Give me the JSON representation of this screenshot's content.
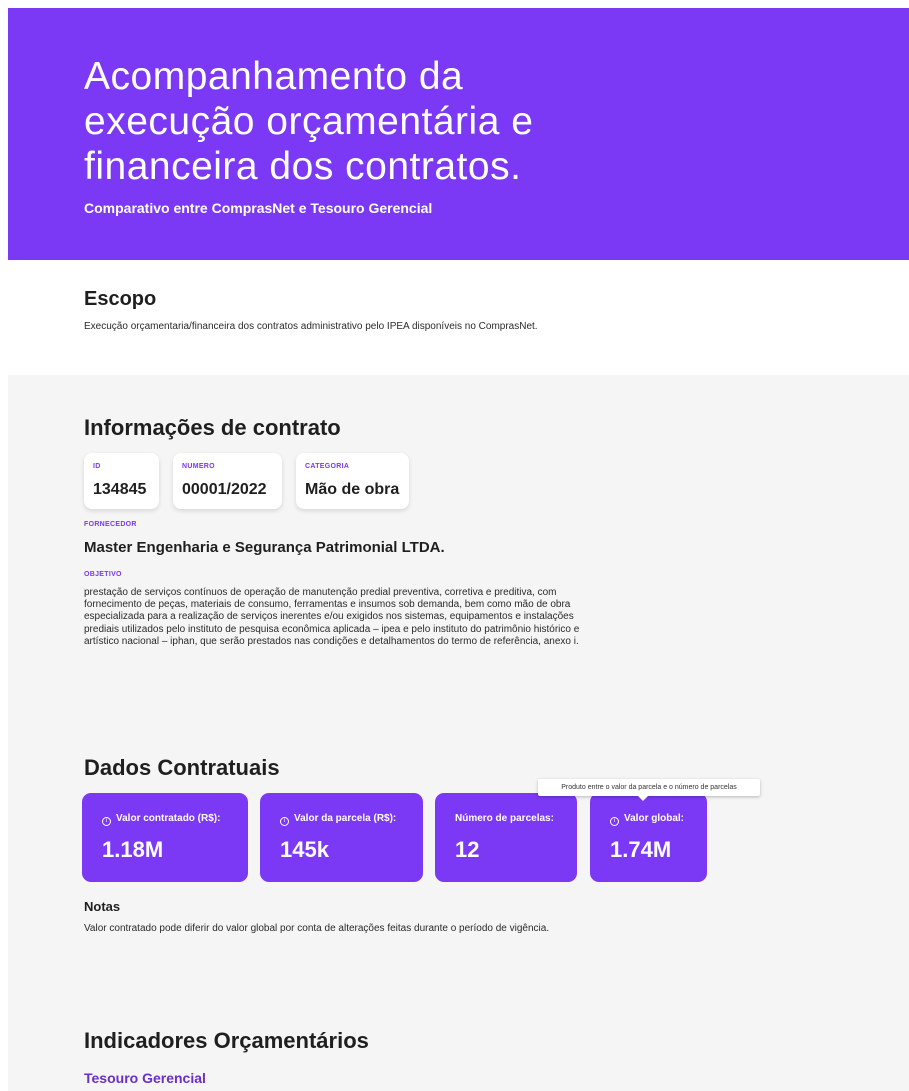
{
  "hero": {
    "title": "Acompanhamento da execução orçamentária e financeira dos contratos.",
    "subtitle": "Comparativo entre ComprasNet e Tesouro Gerencial"
  },
  "scope": {
    "title": "Escopo",
    "text": "Execução orçamentaria/financeira dos contratos administrativo pelo IPEA disponíveis no ComprasNet."
  },
  "contract_info": {
    "title": "Informações de contrato",
    "cards": [
      {
        "label": "ID",
        "value": "134845"
      },
      {
        "label": "NUMERO",
        "value": "00001/2022"
      },
      {
        "label": "CATEGORIA",
        "value": "Mão de obra"
      }
    ],
    "supplier_label": "FORNECEDOR",
    "supplier": "Master Engenharia e Segurança Patrimonial LTDA.",
    "objective_label": "OBJETIVO",
    "objective": "prestação de serviços contínuos de operação de manutenção predial preventiva, corretiva e preditiva, com fornecimento de peças, materiais de consumo, ferramentas e insumos sob demanda, bem como mão de obra especializada para a realização de serviços inerentes e/ou exigidos nos sistemas, equipamentos e instalações prediais utilizados pelo instituto de pesquisa econômica aplicada – ipea e pelo instituto do patrimônio histórico e artístico nacional – iphan, que serão prestados nas condições e detalhamentos do termo de referência, anexo i."
  },
  "contract_data": {
    "title": "Dados Contratuais",
    "metrics": [
      {
        "label": "Valor contratado (R$):",
        "value": "1.18M",
        "info_icon": "info-icon"
      },
      {
        "label": "Valor da parcela (R$):",
        "value": "145k",
        "info_icon": "info-icon"
      },
      {
        "label": "Número de parcelas:",
        "value": "12"
      },
      {
        "label": "Valor global:",
        "value": "1.74M",
        "info_icon": "info-icon"
      }
    ],
    "tooltip": "Produto entre o valor da parcela e o número de parcelas",
    "notes_title": "Notas",
    "notes_text": "Valor contratado pode diferir do valor global por conta de alterações feitas durante o período de vigência."
  },
  "budget_indicators": {
    "title": "Indicadores Orçamentários",
    "subtitle": "Tesouro Gerencial"
  },
  "colors": {
    "accent": "#7b38f5",
    "background_section": "#f5f5f5"
  }
}
